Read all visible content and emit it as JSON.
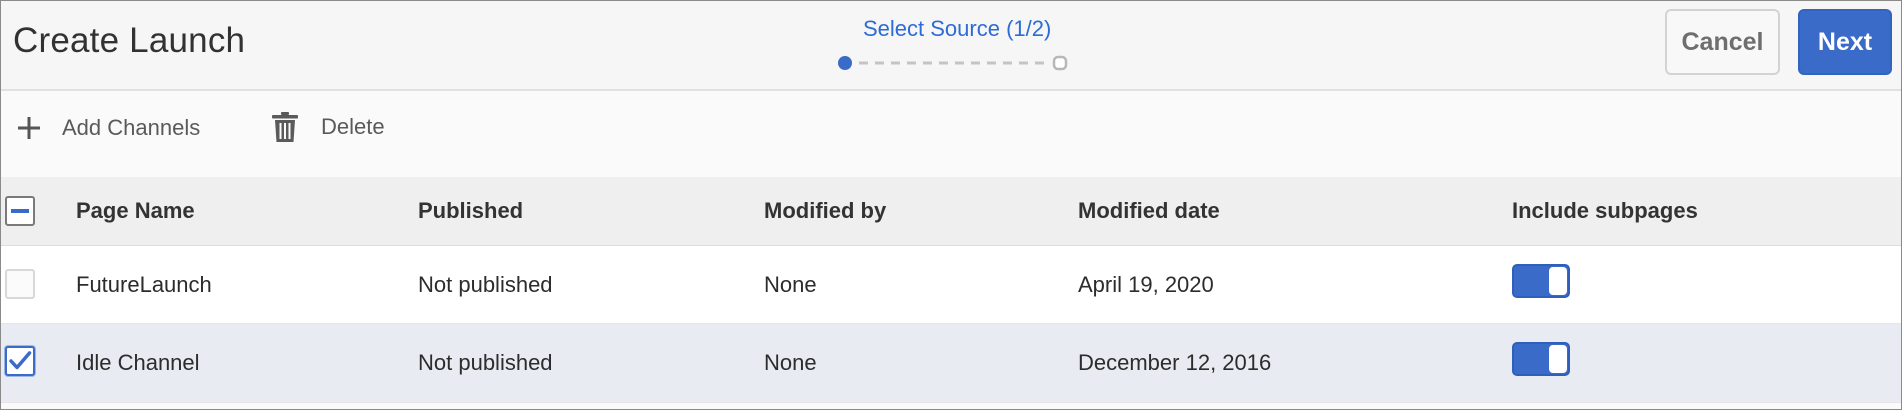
{
  "header": {
    "title": "Create Launch",
    "step_label": "Select Source (1/2)",
    "cancel_label": "Cancel",
    "next_label": "Next"
  },
  "stepper": {
    "current_step": 1,
    "total_steps": 2
  },
  "toolbar": {
    "add_label": "Add Channels",
    "add_icon": "plus-icon",
    "delete_label": "Delete",
    "delete_icon": "trash-icon"
  },
  "table": {
    "columns": [
      "Page Name",
      "Published",
      "Modified by",
      "Modified date",
      "Include subpages"
    ],
    "select_all_state": "indeterminate",
    "rows": [
      {
        "page_name": "FutureLaunch",
        "published": "Not published",
        "modified_by": "None",
        "modified_date": "April 19, 2020",
        "include_subpages": true,
        "selected": false
      },
      {
        "page_name": "Idle Channel",
        "published": "Not published",
        "modified_by": "None",
        "modified_date": "December 12, 2016",
        "include_subpages": true,
        "selected": true
      }
    ]
  },
  "colors": {
    "accent": "#3b6bc9",
    "step_text": "#2d6bd6",
    "selected_row": "#e8ebf2",
    "header_bg": "#f6f6f6"
  }
}
